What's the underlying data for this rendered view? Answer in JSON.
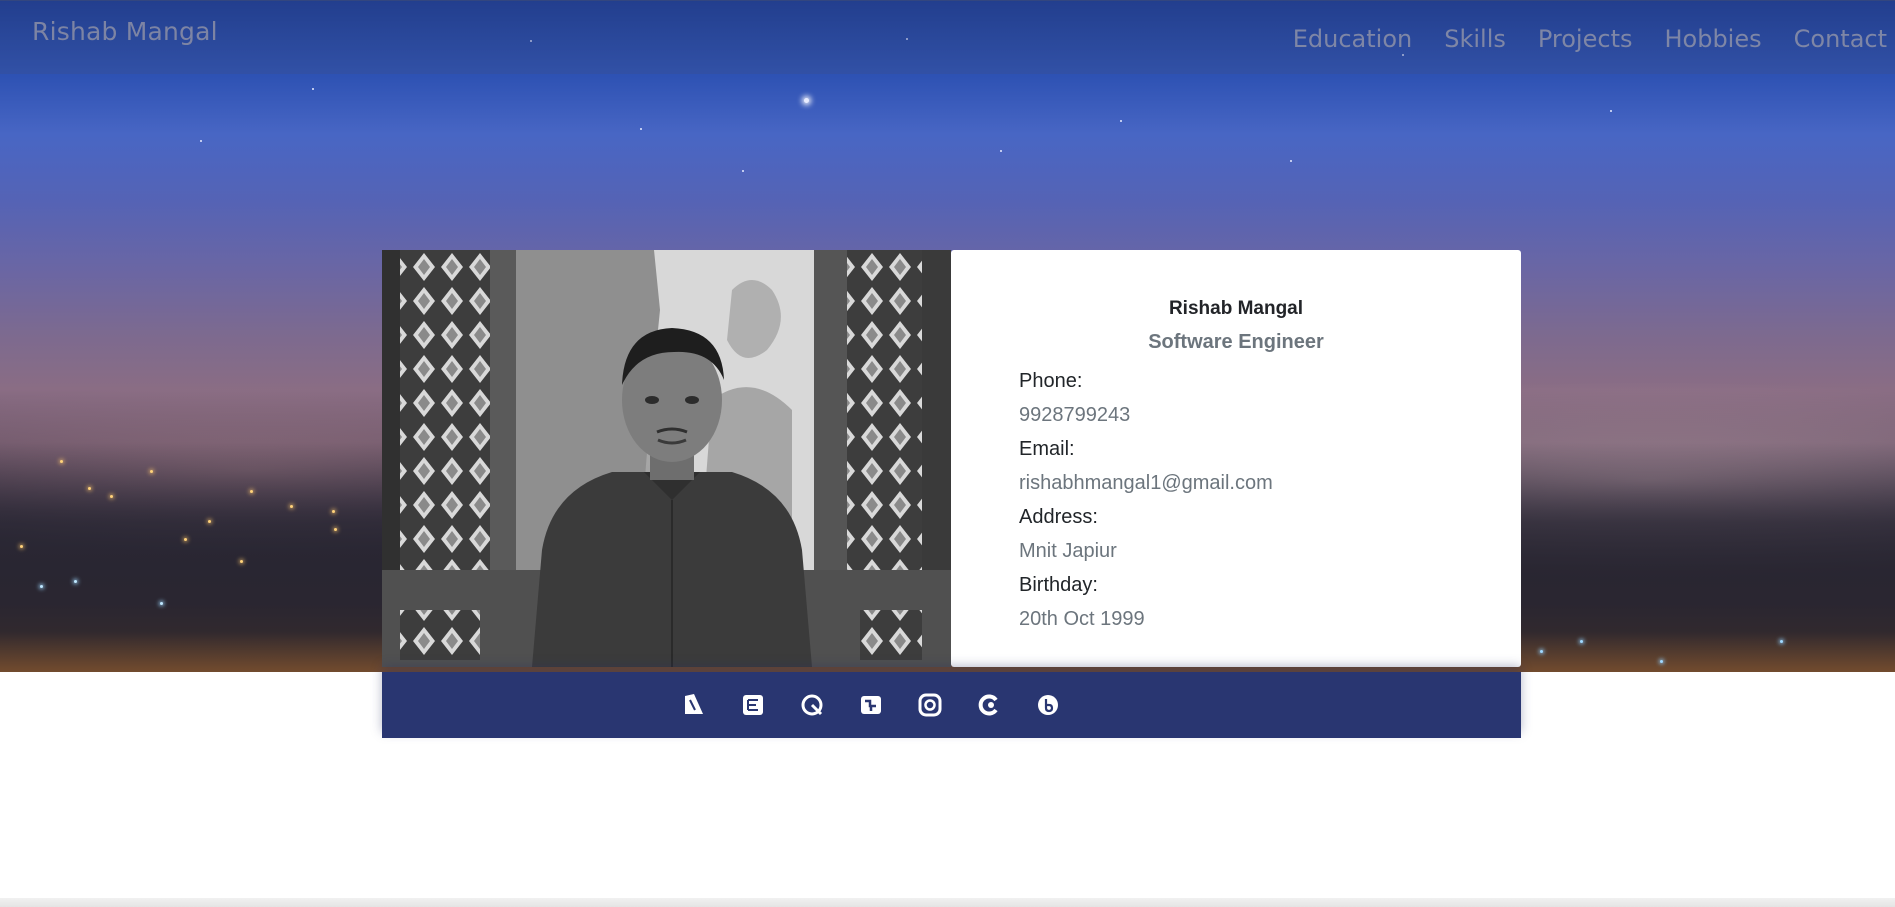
{
  "navbar": {
    "brand": "Rishab Mangal",
    "links": [
      {
        "label": "Education"
      },
      {
        "label": "Skills"
      },
      {
        "label": "Projects"
      },
      {
        "label": "Hobbies"
      },
      {
        "label": "Contact"
      }
    ]
  },
  "profile": {
    "name": "Rishab Mangal",
    "title": "Software Engineer",
    "fields": [
      {
        "label": "Phone:",
        "value": "9928799243"
      },
      {
        "label": "Email:",
        "value": "rishabhmangal1@gmail.com"
      },
      {
        "label": "Address:",
        "value": "Mnit Japiur"
      },
      {
        "label": "Birthday:",
        "value": "20th Oct 1999"
      }
    ]
  },
  "social": {
    "icons": [
      "social-icon-1",
      "social-icon-2",
      "social-icon-3",
      "social-icon-4",
      "social-icon-5",
      "social-icon-6",
      "social-icon-7"
    ]
  },
  "colors": {
    "social_bar": "#293671",
    "nav_text": "#7e86a6",
    "muted_text": "#6c757d"
  }
}
